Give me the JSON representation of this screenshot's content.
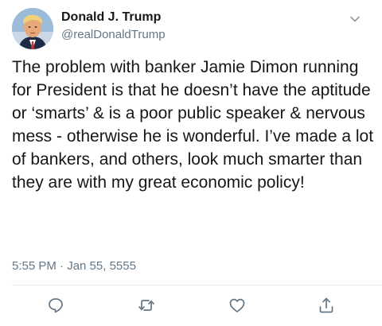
{
  "tweet": {
    "author": {
      "display_name": "Donald J. Trump",
      "handle": "@realDonaldTrump",
      "avatar_icon": "profile-photo"
    },
    "text": "The problem with banker Jamie Dimon running for President is that he doesn’t have the aptitude or ‘smarts’ & is a poor public speaker & nervous mess - otherwise he is wonderful. I’ve made a lot of bankers, and others, look much smarter than they are with my great economic policy!",
    "timestamp": "5:55 PM · Jan 55, 5555",
    "actions": [
      {
        "name": "reply",
        "icon": "reply-icon"
      },
      {
        "name": "retweet",
        "icon": "retweet-icon"
      },
      {
        "name": "like",
        "icon": "heart-icon"
      },
      {
        "name": "share",
        "icon": "share-icon"
      }
    ],
    "colors": {
      "primary_text": "#14171a",
      "secondary_text": "#657786",
      "icon": "#657786",
      "divider": "#e6ecf0"
    }
  }
}
